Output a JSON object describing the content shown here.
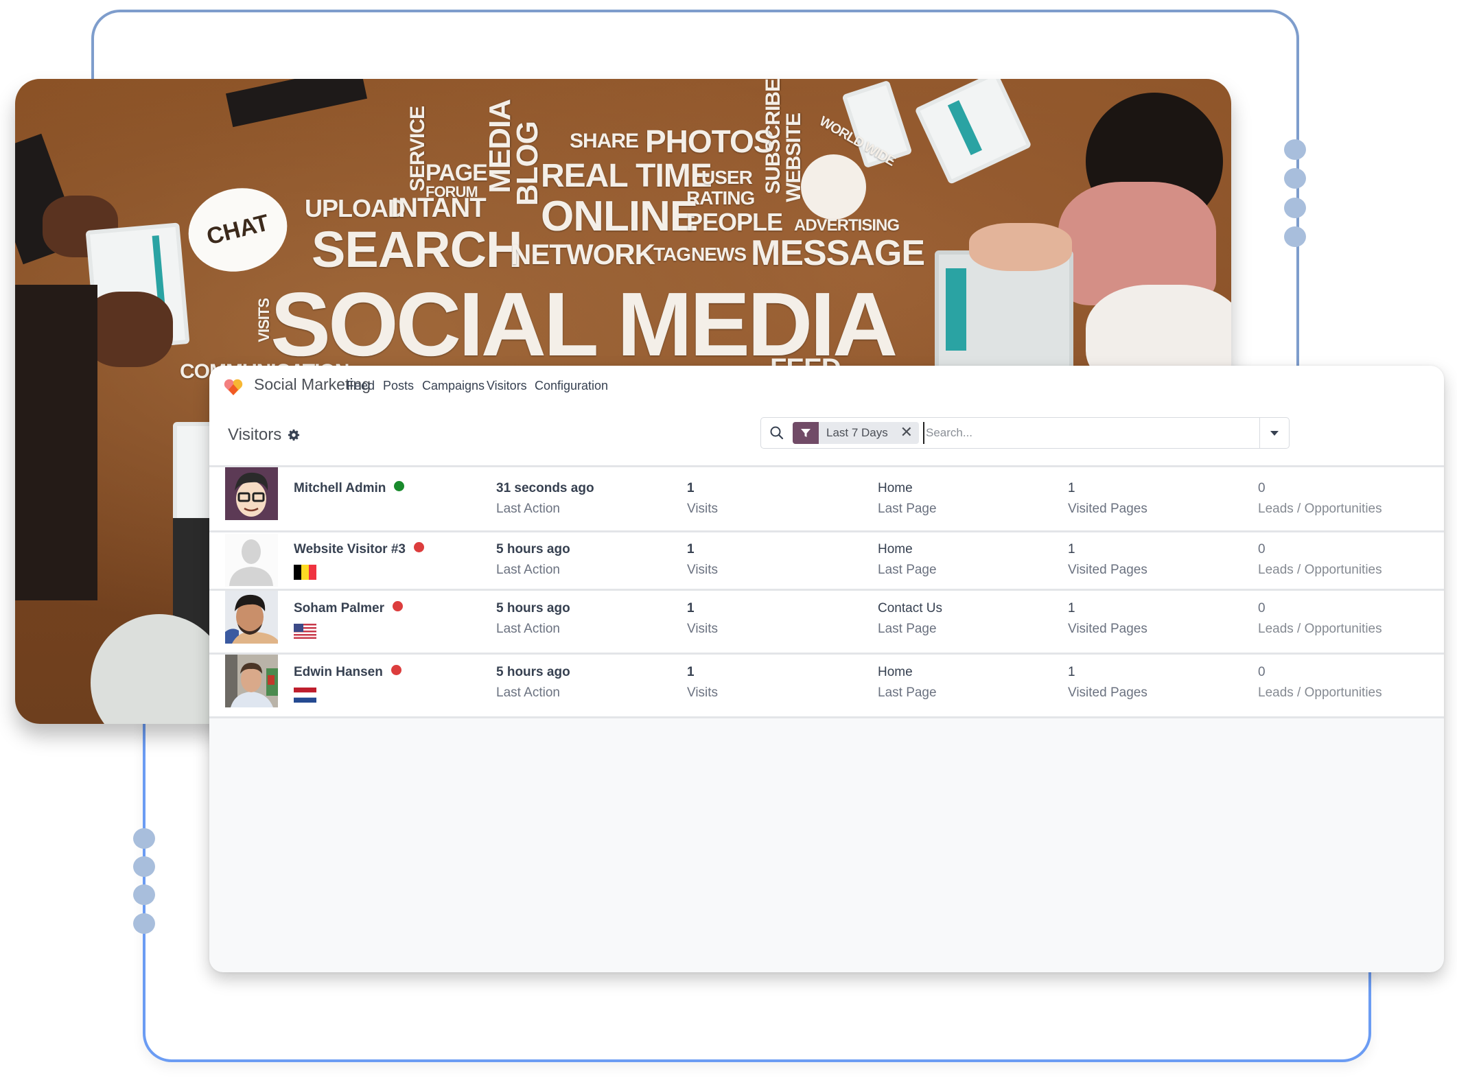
{
  "hero_image": {
    "alt": "Social media word cloud on a wooden desk with people using tablets and laptops",
    "headline": "SOCIAL MEDIA",
    "words": [
      "SERVICE",
      "PAGE",
      "FORUM",
      "MEDIA",
      "BLOG",
      "SHARE",
      "PHOTOS",
      "SUBSCRIBE",
      "WEBSITE",
      "WORLD WIDE",
      "REAL TIME",
      "USER",
      "RATING",
      "UPLOAD",
      "INTANT",
      "ONLINE",
      "PEOPLE",
      "ADVERTISING",
      "CHAT",
      "SEARCH",
      "NETWORK",
      "TAG",
      "NEWS",
      "MESSAGE",
      "VISITS",
      "COMMUNICATION",
      "FEED"
    ]
  },
  "app": {
    "name": "Social Marketing",
    "nav": [
      "Feed",
      "Posts",
      "Campaigns",
      "Visitors",
      "Configuration"
    ]
  },
  "control": {
    "breadcrumb": "Visitors",
    "search": {
      "facet_label": "Last 7 Days",
      "placeholder": "Search..."
    }
  },
  "colors": {
    "brand": "#714b67",
    "online": "#198a2c",
    "offline": "#dc3d3d"
  },
  "visitors": [
    {
      "name": "Mitchell Admin",
      "status": "online",
      "flag": null,
      "last_action": "31 seconds ago",
      "last_action_label": "Last Action",
      "visits": "1",
      "visits_label": "Visits",
      "last_page": "Home",
      "last_page_label": "Last Page",
      "visited_pages": "1",
      "visited_pages_label": "Visited Pages",
      "leads": "0",
      "leads_label": "Leads / Opportunities"
    },
    {
      "name": "Website Visitor #3",
      "status": "offline",
      "flag": "Belgium",
      "last_action": "5 hours ago",
      "last_action_label": "Last Action",
      "visits": "1",
      "visits_label": "Visits",
      "last_page": "Home",
      "last_page_label": "Last Page",
      "visited_pages": "1",
      "visited_pages_label": "Visited Pages",
      "leads": "0",
      "leads_label": "Leads / Opportunities"
    },
    {
      "name": "Soham Palmer",
      "status": "offline",
      "flag": "United States",
      "last_action": "5 hours ago",
      "last_action_label": "Last Action",
      "visits": "1",
      "visits_label": "Visits",
      "last_page": "Contact Us",
      "last_page_label": "Last Page",
      "visited_pages": "1",
      "visited_pages_label": "Visited Pages",
      "leads": "0",
      "leads_label": "Leads / Opportunities"
    },
    {
      "name": "Edwin Hansen",
      "status": "offline",
      "flag": "Netherlands",
      "last_action": "5 hours ago",
      "last_action_label": "Last Action",
      "visits": "1",
      "visits_label": "Visits",
      "last_page": "Home",
      "last_page_label": "Last Page",
      "visited_pages": "1",
      "visited_pages_label": "Visited Pages",
      "leads": "0",
      "leads_label": "Leads / Opportunities"
    }
  ]
}
